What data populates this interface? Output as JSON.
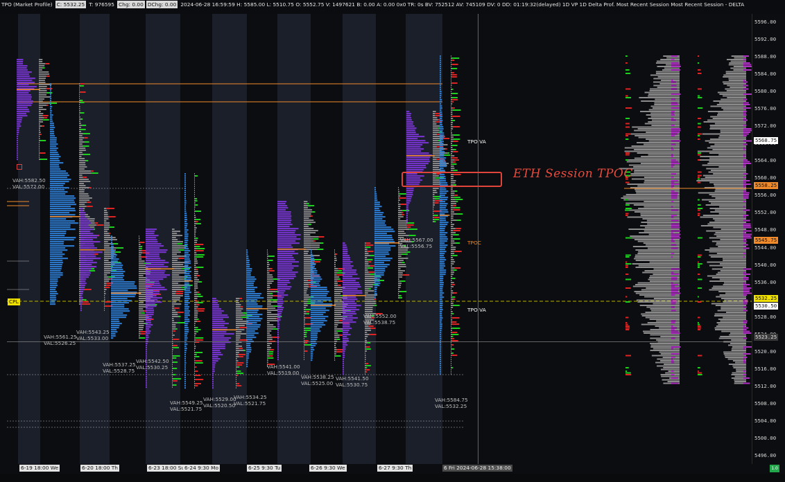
{
  "infobar": {
    "items": [
      {
        "text": "TPO (Market Profile)",
        "boxed": false
      },
      {
        "text": "C: 5532.25",
        "boxed": true
      },
      {
        "text": "T: 976595",
        "boxed": false
      },
      {
        "text": "Chg: 0.00",
        "boxed": true
      },
      {
        "text": "DChg: 0.00",
        "boxed": true
      },
      {
        "text": "2024-06-28 16:59:59 H: 5585.00 L: 5510.75 O: 5552.75 V: 1497621 B: 0.00 A: 0.00 0x0 TR: 0s BV: 752512 AV: 745109 DV: 0 DD: 01:19:32(delayed) 1D VP 1D Delta Prof. Most Recent Session Most Recent Session - DELTA",
        "boxed": false
      }
    ]
  },
  "price_axis": {
    "ticks": [
      "5596.00",
      "5592.00",
      "5588.00",
      "5584.00",
      "5580.00",
      "5576.00",
      "5572.00",
      "5568.00",
      "5564.00",
      "5560.00",
      "5556.00",
      "5552.00",
      "5548.00",
      "5544.00",
      "5540.00",
      "5536.00",
      "5532.00",
      "5528.00",
      "5524.00",
      "5520.00",
      "5516.00",
      "5512.00",
      "5508.00",
      "5504.00",
      "5500.00",
      "5496.00"
    ],
    "badges": [
      {
        "text": "5568.75",
        "price": 5568.75,
        "bg": "#ffffff",
        "fg": "#111111"
      },
      {
        "text": "5558.25",
        "price": 5558.25,
        "bg": "#f08a2a",
        "fg": "#111111"
      },
      {
        "text": "5545.75",
        "price": 5545.75,
        "bg": "#f08a2a",
        "fg": "#111111"
      },
      {
        "text": "5532.25",
        "price": 5532.25,
        "bg": "#f0e000",
        "fg": "#111111"
      },
      {
        "text": "5530.50",
        "price": 5530.5,
        "bg": "#ffffff",
        "fg": "#111111"
      },
      {
        "text": "5523.25",
        "price": 5523.25,
        "bg": "#3a3a3a",
        "fg": "#e0e0e0"
      }
    ],
    "poc_tag": "NVPOC"
  },
  "time_axis": {
    "labels": [
      {
        "text": "6-19  18:00  We",
        "cur": false
      },
      {
        "text": "6-20  18:00  Th",
        "cur": false
      },
      {
        "text": "6-23  18:00  Su",
        "cur": false
      },
      {
        "text": "6-24  9:30  Mo",
        "cur": false
      },
      {
        "text": "6-25  9:30  Tu",
        "cur": false
      },
      {
        "text": "6-26  9:30  We",
        "cur": false
      },
      {
        "text": "6-27  9:30  Th",
        "cur": false
      },
      {
        "text": "6  Fri 2024-06-28  15:38:00",
        "cur": true
      }
    ]
  },
  "value_area_labels": [
    {
      "vah": "VAH:5561.25",
      "val": "VAL:5526.25"
    },
    {
      "vah": "VAH:5543.25",
      "val": "VAL:5533.00"
    },
    {
      "vah": "VAH:5537.25",
      "val": "VAL:5528.75"
    },
    {
      "vah": "VAH:5542.50",
      "val": "VAL:5530.25"
    },
    {
      "vah": "VAH:5549.25",
      "val": "VAL:5521.75"
    },
    {
      "vah": "VAH:5529.00",
      "val": "VAL:5520.50"
    },
    {
      "vah": "VAH:5534.25",
      "val": "VAL:5521.75"
    },
    {
      "vah": "VAH:5541.00",
      "val": "VAL:5519.00"
    },
    {
      "vah": "VAH:5538.25",
      "val": "VAL:5525.00"
    },
    {
      "vah": "VAH:5541.50",
      "val": "VAL:5530.75"
    },
    {
      "vah": "VAH:5552.00",
      "val": "VAL:5538.75"
    },
    {
      "vah": "VAH:5567.00",
      "val": "VAL:5556.75"
    },
    {
      "vah": "VAH:5584.75",
      "val": "VAL:5532.25"
    }
  ],
  "top_left_labels": {
    "vah": "VAH:5582.50",
    "val": "VAL:5572.00"
  },
  "side_labels": {
    "tpo_va_top": "TPO VA",
    "tpoc": "TPOC",
    "tpo_va_bottom": "TPO VA"
  },
  "cpl_label": "CPL",
  "annotation": {
    "text": "ETH Session TPOC",
    "color": "#e74a3e"
  },
  "corner_button": "1.0",
  "colors": {
    "blue": "#2f7fd6",
    "purple": "#7b35d6",
    "green": "#1fd11f",
    "red": "#e02323",
    "magenta": "#b02fc4",
    "gray": "#9a9a9a",
    "orange": "#f08a2a",
    "session_bg": "#1b1f2a"
  }
}
